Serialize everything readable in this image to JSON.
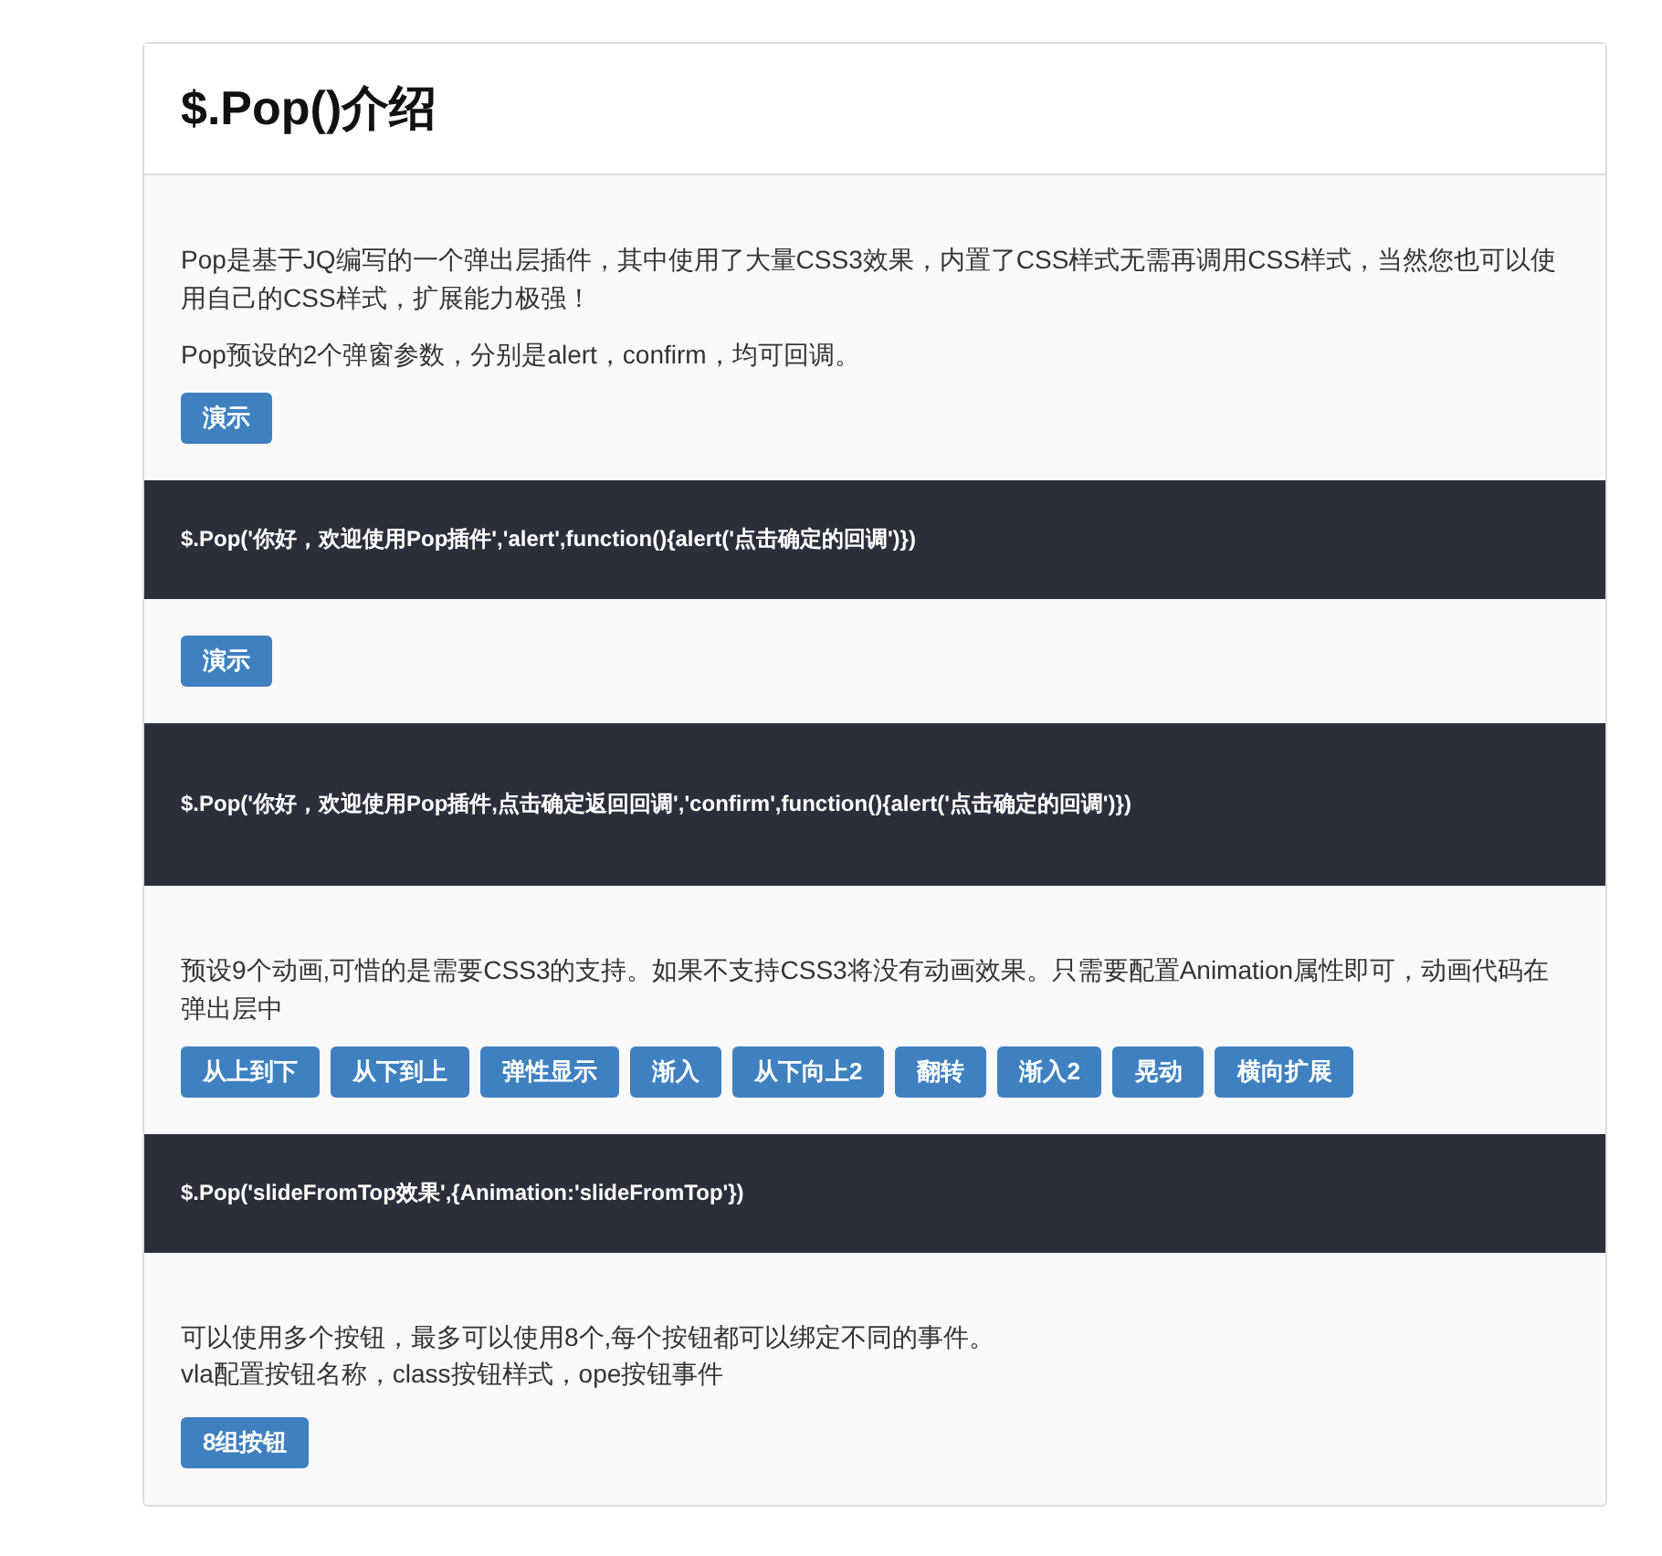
{
  "title": "$.Pop()介绍",
  "blocks": [
    {
      "kind": "text",
      "paragraphs": [
        "Pop是基于JQ编写的一个弹出层插件，其中使用了大量CSS3效果，内置了CSS样式无需再调用CSS样式，当然您也可以使用自己的CSS样式，扩展能力极强！",
        "Pop预设的2个弹窗参数，分别是alert，confirm，均可回调。"
      ],
      "buttons": [
        "演示"
      ]
    },
    {
      "kind": "code",
      "code": "$.Pop('你好，欢迎使用Pop插件','alert',function(){alert('点击确定的回调')})"
    },
    {
      "kind": "text",
      "buttons": [
        "演示"
      ]
    },
    {
      "kind": "code",
      "code": "$.Pop('你好，欢迎使用Pop插件,点击确定返回回调','confirm',function(){alert('点击确定的回调')})"
    },
    {
      "kind": "text",
      "paragraphs": [
        "预设9个动画,可惜的是需要CSS3的支持。如果不支持CSS3将没有动画效果。只需要配置Animation属性即可，动画代码在弹出层中"
      ],
      "buttons": [
        "从上到下",
        "从下到上",
        "弹性显示",
        "渐入",
        "从下向上2",
        "翻转",
        "渐入2",
        "晃动",
        "横向扩展"
      ]
    },
    {
      "kind": "code",
      "code": "$.Pop('slideFromTop效果',{Animation:'slideFromTop'})"
    },
    {
      "kind": "text",
      "lines": [
        "可以使用多个按钮，最多可以使用8个,每个按钮都可以绑定不同的事件。",
        "vla配置按钮名称，class按钮样式，ope按钮事件"
      ],
      "buttons": [
        "8组按钮"
      ]
    }
  ]
}
